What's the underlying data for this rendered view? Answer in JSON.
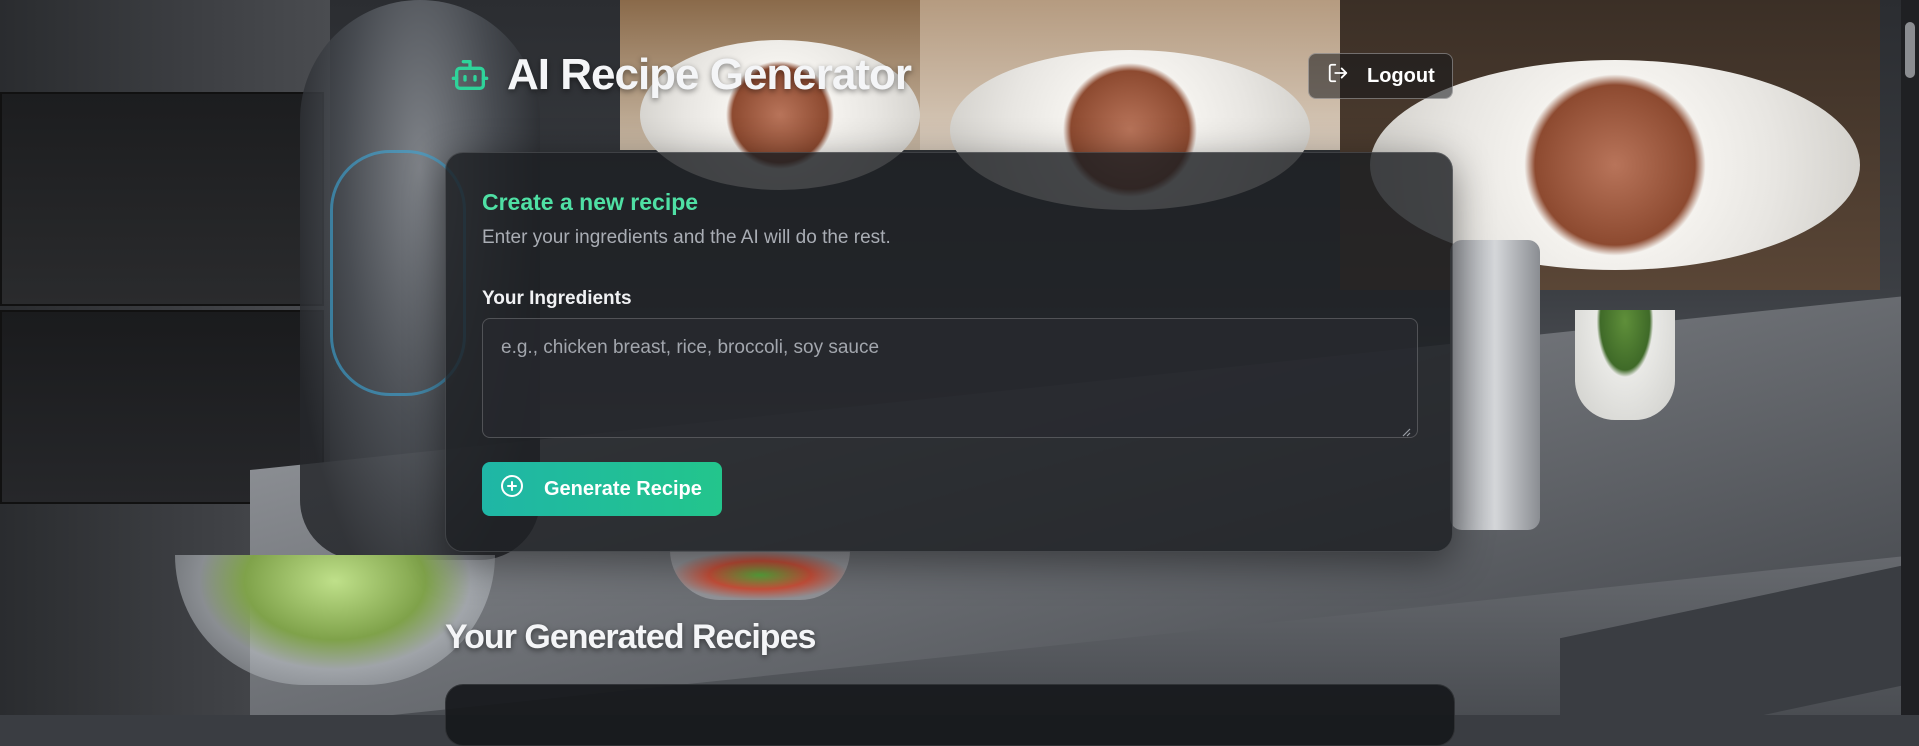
{
  "header": {
    "app_title": "AI Recipe Generator",
    "logout_label": "Logout"
  },
  "create_card": {
    "title": "Create a new recipe",
    "subtitle": "Enter your ingredients and the AI will do the rest.",
    "ingredients_label": "Your Ingredients",
    "ingredients_placeholder": "e.g., chicken breast, rice, broccoli, soy sauce",
    "ingredients_value": "",
    "generate_label": "Generate Recipe"
  },
  "results": {
    "title": "Your Generated Recipes"
  },
  "colors": {
    "accent": "#4fe0a4",
    "button_gradient_start": "#1fb6a6",
    "button_gradient_end": "#23c58c"
  },
  "icons": {
    "brand": "robot-icon",
    "logout": "logout-icon",
    "generate": "plus-circle-icon"
  }
}
